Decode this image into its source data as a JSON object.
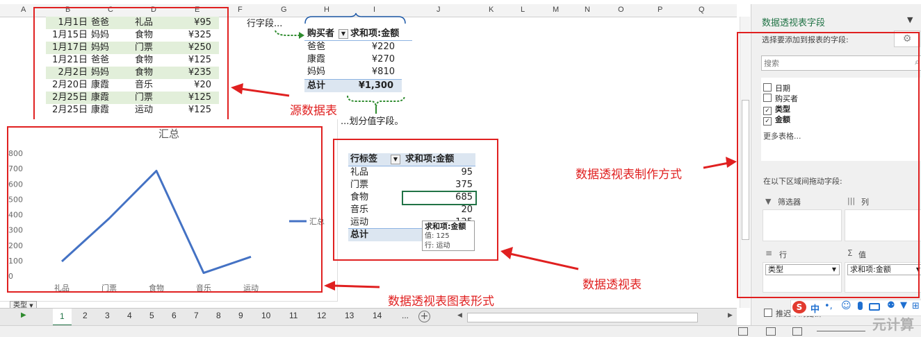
{
  "columns": [
    "A",
    "B",
    "C",
    "D",
    "E",
    "F",
    "G",
    "H",
    "I",
    "J",
    "K",
    "L",
    "M",
    "N",
    "O",
    "P",
    "Q"
  ],
  "source_rows": [
    {
      "date": "1月1日",
      "buyer": "爸爸",
      "type": "礼品",
      "amount": "¥95"
    },
    {
      "date": "1月15日",
      "buyer": "妈妈",
      "type": "食物",
      "amount": "¥325"
    },
    {
      "date": "1月17日",
      "buyer": "妈妈",
      "type": "门票",
      "amount": "¥250"
    },
    {
      "date": "1月21日",
      "buyer": "爸爸",
      "type": "食物",
      "amount": "¥125"
    },
    {
      "date": "2月2日",
      "buyer": "妈妈",
      "type": "食物",
      "amount": "¥235"
    },
    {
      "date": "2月20日",
      "buyer": "康霞",
      "type": "音乐",
      "amount": "¥20"
    },
    {
      "date": "2月25日",
      "buyer": "康霞",
      "type": "门票",
      "amount": "¥125"
    },
    {
      "date": "2月25日",
      "buyer": "康霞",
      "type": "运动",
      "amount": "¥125"
    }
  ],
  "pivot1": {
    "row_field_label": "行字段...",
    "header_buyer": "购买者",
    "header_sum": "求和项:金额",
    "rows": [
      {
        "name": "爸爸",
        "value": "¥220"
      },
      {
        "name": "康霞",
        "value": "¥270"
      },
      {
        "name": "妈妈",
        "value": "¥810"
      }
    ],
    "total_label": "总计",
    "total_value": "¥1,300",
    "value_field_label": "...划分值字段。"
  },
  "pivot2": {
    "header_row": "行标签",
    "header_sum": "求和项:金额",
    "rows": [
      {
        "name": "礼品",
        "value": "95"
      },
      {
        "name": "门票",
        "value": "375"
      },
      {
        "name": "食物",
        "value": "685"
      },
      {
        "name": "音乐",
        "value": "20"
      },
      {
        "name": "运动",
        "value": "125"
      }
    ],
    "total_label": "总计",
    "tooltip": {
      "title": "求和项:金额",
      "value_line": "值: 125",
      "row_line": "行: 运动"
    }
  },
  "annotations": {
    "source": "源数据表",
    "method": "数据透视表制作方式",
    "pivot": "数据透视表",
    "chart": "数据透视表图表形式"
  },
  "chart_data": {
    "type": "line",
    "title": "汇总",
    "categories": [
      "礼品",
      "门票",
      "食物",
      "音乐",
      "运动"
    ],
    "series": [
      {
        "name": "汇总",
        "values": [
          95,
          375,
          685,
          20,
          125
        ]
      }
    ],
    "ylim": [
      0,
      800
    ],
    "yticks": [
      "800",
      "700",
      "600",
      "500",
      "400",
      "300",
      "200",
      "100",
      "0"
    ],
    "legend": "right",
    "color": "#4472c4",
    "filter_button": "类型"
  },
  "sheet_tabs": [
    "1",
    "2",
    "3",
    "4",
    "5",
    "6",
    "7",
    "8",
    "9",
    "10",
    "11",
    "12",
    "13",
    "14",
    "..."
  ],
  "panel": {
    "title": "数据透视表字段",
    "subtitle": "选择要添加到报表的字段:",
    "search_placeholder": "搜索",
    "fields": [
      {
        "label": "日期",
        "checked": false
      },
      {
        "label": "购买者",
        "checked": false
      },
      {
        "label": "类型",
        "checked": true
      },
      {
        "label": "金额",
        "checked": true
      }
    ],
    "more_tables": "更多表格...",
    "drag_label": "在以下区域间拖动字段:",
    "filter_label": "筛选器",
    "columns_label": "列",
    "rows_label": "行",
    "values_label": "值",
    "row_item": "类型",
    "value_item": "求和项:金额",
    "defer_label": "推迟布局更新"
  },
  "watermark": "元计算",
  "ime_label": "中"
}
